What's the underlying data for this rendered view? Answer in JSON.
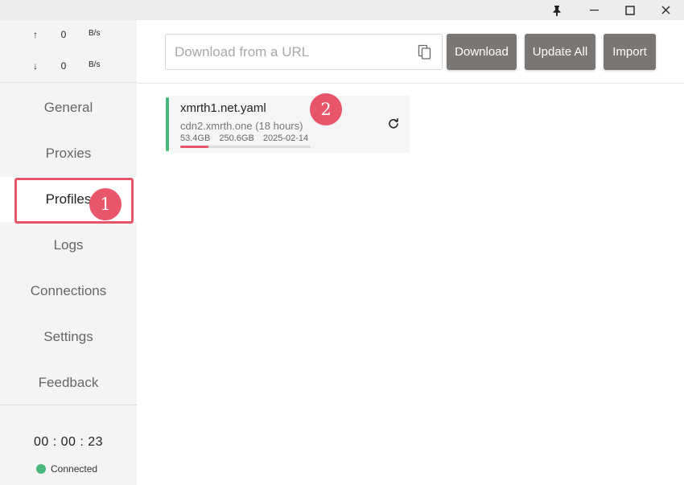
{
  "titlebar": {
    "pin_glyph": "📌",
    "minimize_glyph": "–",
    "maximize_glyph": "☐",
    "close_glyph": "✕"
  },
  "traffic": {
    "up_arrow": "↑",
    "up_value": "0",
    "up_unit": "B/s",
    "down_arrow": "↓",
    "down_value": "0",
    "down_unit": "B/s"
  },
  "nav": {
    "items": [
      {
        "label": "General"
      },
      {
        "label": "Proxies"
      },
      {
        "label": "Profiles",
        "active": true
      },
      {
        "label": "Logs"
      },
      {
        "label": "Connections"
      },
      {
        "label": "Settings"
      },
      {
        "label": "Feedback"
      }
    ]
  },
  "footer": {
    "timer": "00 : 00 : 23",
    "status": "Connected",
    "status_color": "#47b87a"
  },
  "header": {
    "url_placeholder": "Download from a URL",
    "url_value": "",
    "download_label": "Download",
    "update_all_label": "Update All",
    "import_label": "Import"
  },
  "profile": {
    "name": "xmrth1.net.yaml",
    "host": "cdn2.xmrth.one (18 hours)",
    "used": "53.4GB",
    "total": "250.6GB",
    "expires": "2025-02-14",
    "usage_fraction": 0.213
  },
  "annotations": {
    "marker_1": "1",
    "marker_2": "2",
    "color": "#e8546a"
  },
  "colors": {
    "button_bg": "#7a7674",
    "accent_green": "#47b87a"
  }
}
